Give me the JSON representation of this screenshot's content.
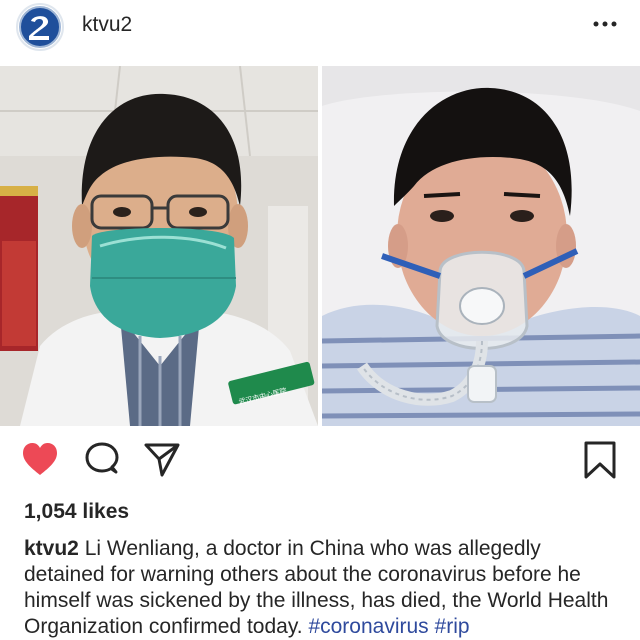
{
  "post": {
    "username": "ktvu2",
    "avatar_icon": "ktvu2-logo-icon",
    "more_icon": "more-options-icon"
  },
  "actions": {
    "like_icon": "heart-filled-icon",
    "comment_icon": "comment-icon",
    "share_icon": "send-icon",
    "save_icon": "bookmark-icon",
    "like_color": "#ed4956"
  },
  "likes": {
    "text": "1,054 likes"
  },
  "caption": {
    "username": "ktvu2",
    "text": "Li Wenliang, a doctor in China who was allegedly detained for warning others about the coronavirus before he himself was sickened by the illness, has died, the World Health Organization confirmed today.",
    "hashtags": [
      "#coronavirus",
      "#rip"
    ]
  },
  "photos": {
    "left": {
      "badge_text": "武汉市中心医院"
    },
    "right": {}
  }
}
